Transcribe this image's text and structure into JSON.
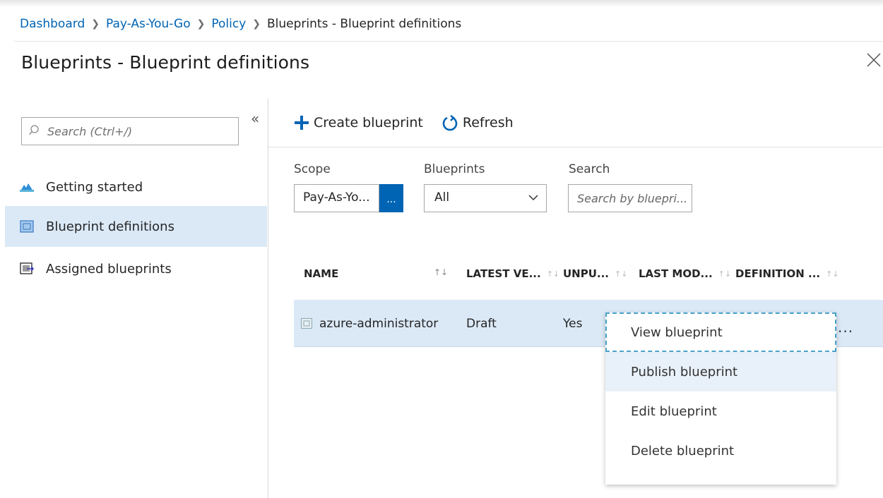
{
  "breadcrumb": [
    {
      "label": "Dashboard"
    },
    {
      "label": "Pay-As-You-Go"
    },
    {
      "label": "Policy"
    },
    {
      "label": "Blueprints - Blueprint definitions"
    }
  ],
  "page": {
    "title": "Blueprints - Blueprint definitions",
    "close_glyph": "╳"
  },
  "sidebar": {
    "search_placeholder": "Search (Ctrl+/)",
    "collapse_glyph": "«",
    "items": [
      {
        "label": "Getting started",
        "icon": "cloud-icon",
        "active": false
      },
      {
        "label": "Blueprint definitions",
        "icon": "blueprint-icon",
        "active": true
      },
      {
        "label": "Assigned blueprints",
        "icon": "assigned-blueprint-icon",
        "active": false
      }
    ]
  },
  "toolbar": {
    "create_label": "Create blueprint",
    "refresh_label": "Refresh"
  },
  "filters": {
    "scope_label": "Scope",
    "scope_value": "Pay-As-Yo...",
    "scope_button": "...",
    "blueprints_label": "Blueprints",
    "blueprints_value": "All",
    "search_label": "Search",
    "search_placeholder": "Search by bluepri..."
  },
  "table": {
    "columns": [
      "NAME",
      "LATEST VE...",
      "UNPU...",
      "LAST MOD...",
      "DEFINITION ..."
    ],
    "rows": [
      {
        "name": "azure-administrator",
        "latest_version": "Draft",
        "unpublished": "Yes"
      }
    ],
    "more_glyph": "..."
  },
  "context_menu": {
    "items": [
      "View blueprint",
      "Publish blueprint",
      "Edit blueprint",
      "Delete blueprint"
    ]
  },
  "colors": {
    "accent": "#0064b4",
    "selected_bg": "#dbe9f7"
  }
}
